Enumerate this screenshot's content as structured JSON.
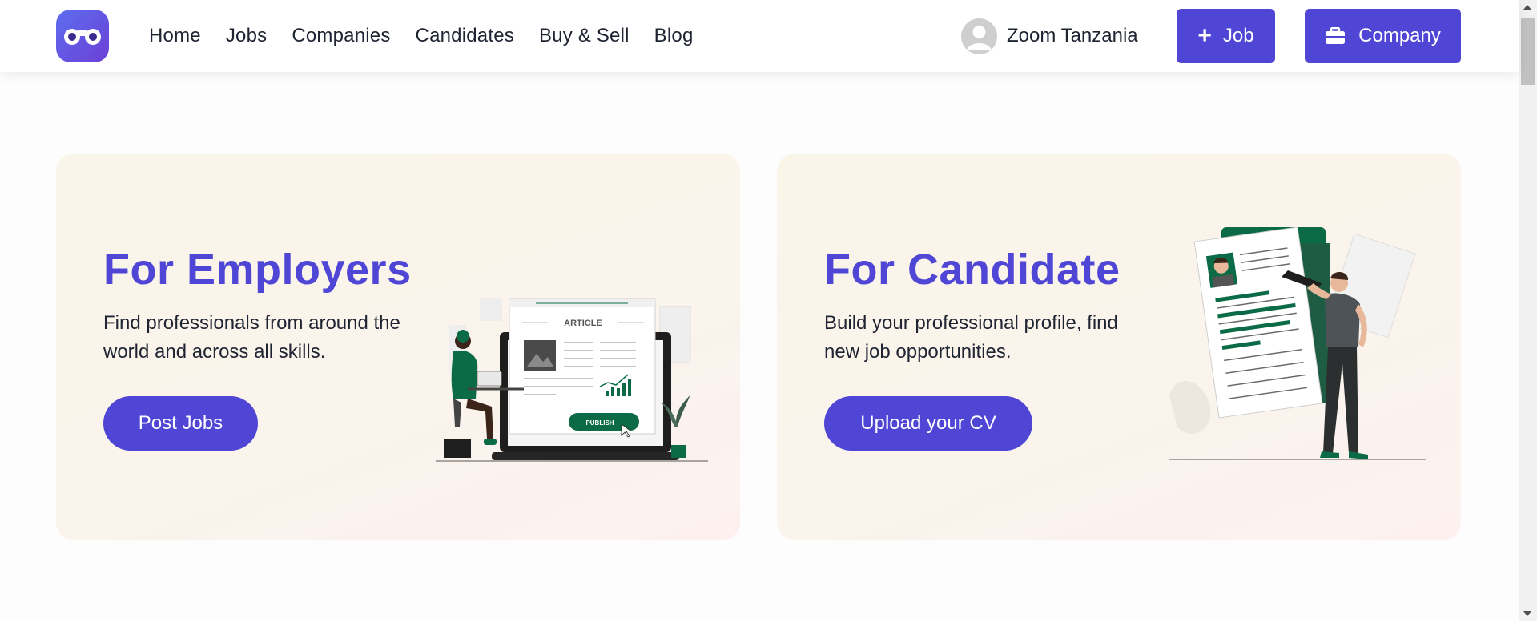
{
  "header": {
    "nav": [
      "Home",
      "Jobs",
      "Companies",
      "Candidates",
      "Buy & Sell",
      "Blog"
    ],
    "user_name": "Zoom Tanzania",
    "job_button": "Job",
    "company_button": "Company"
  },
  "employers": {
    "title": "For Employers",
    "description": "Find professionals from around the world and across all skills.",
    "cta": "Post Jobs",
    "illustration_article": "ARTICLE",
    "illustration_publish": "PUBLISH"
  },
  "candidates": {
    "title": "For Candidate",
    "description": "Build your professional profile, find new job opportunities.",
    "cta": "Upload your CV"
  },
  "colors": {
    "accent": "#4f46d5",
    "illustration_green": "#0b6b47",
    "card_bg": "#f9f5ec"
  }
}
